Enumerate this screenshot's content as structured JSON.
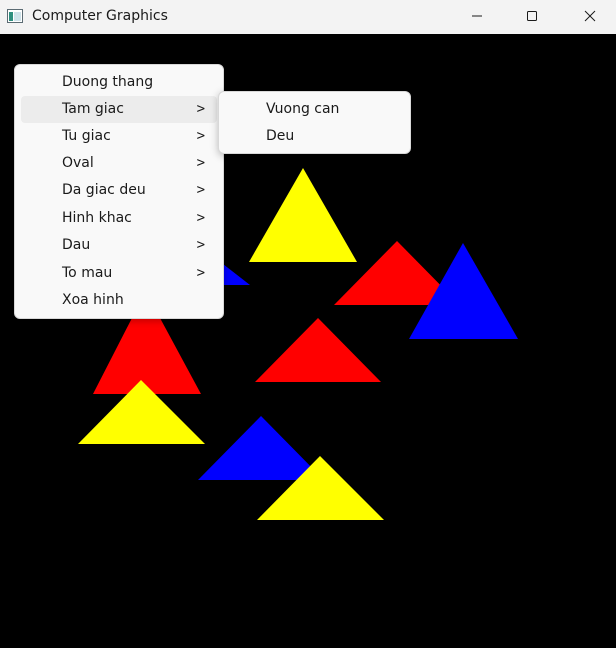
{
  "window": {
    "title": "Computer Graphics",
    "icon": "app-window-icon",
    "controls": [
      "minimize-icon",
      "maximize-icon",
      "close-icon"
    ]
  },
  "canvas": {
    "background": "#000000",
    "colors": {
      "red": "#ff0000",
      "yellow": "#ffff00",
      "blue": "#0000ff"
    }
  },
  "context_menu": {
    "items": [
      {
        "label": "Duong thang",
        "has_submenu": false
      },
      {
        "label": "Tam giac",
        "has_submenu": true,
        "highlighted": true
      },
      {
        "label": "Tu giac",
        "has_submenu": true
      },
      {
        "label": "Oval",
        "has_submenu": true
      },
      {
        "label": "Da giac deu",
        "has_submenu": true
      },
      {
        "label": "Hinh khac",
        "has_submenu": true
      },
      {
        "label": "Dau",
        "has_submenu": true
      },
      {
        "label": "To mau",
        "has_submenu": true
      },
      {
        "label": "Xoa hinh",
        "has_submenu": false
      }
    ],
    "chevron": ">"
  },
  "submenu": {
    "items": [
      {
        "label": "Vuong can"
      },
      {
        "label": "Deu"
      }
    ]
  }
}
